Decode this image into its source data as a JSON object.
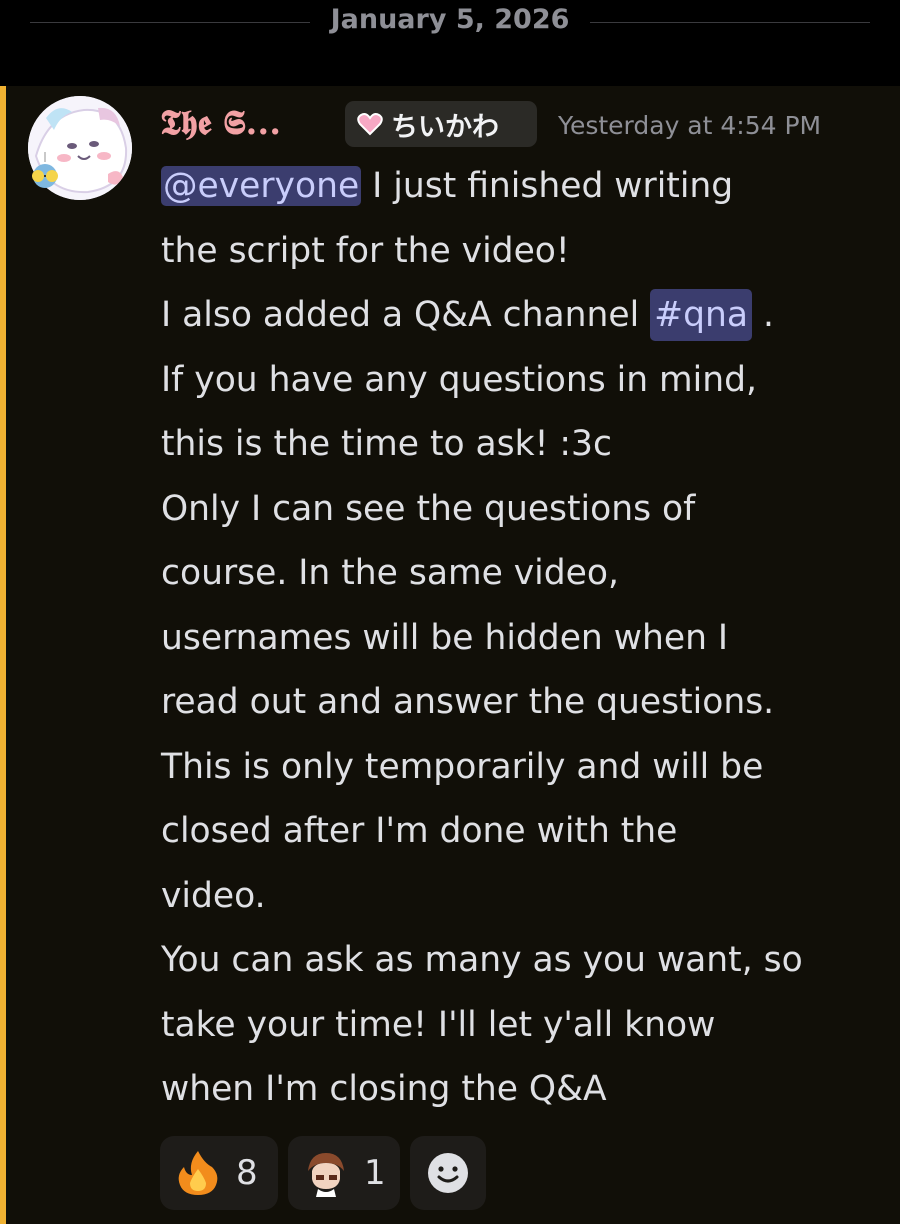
{
  "date_divider": {
    "label": "January 5, 2026"
  },
  "message": {
    "author": "𝕿𝖍𝖊 𝕾...",
    "role_tag": "ちいかわ",
    "timestamp": "Yesterday at 4:54 PM",
    "mention_everyone": "@everyone",
    "line1_rest": " I just finished writing",
    "line2": "the script for the video!",
    "line3_pre": "I also added a Q&A channel ",
    "channel_mention": "#qna",
    "line3_post": " .",
    "line4": "If you have any questions in mind,",
    "line5": "this is the time to ask! :3c",
    "line6": "Only I can see the questions of",
    "line7": "course. In the same video,",
    "line8": "usernames will be hidden when I",
    "line9": "read out and answer the questions.",
    "line10": "This is only temporarily and will be",
    "line11": "closed after I'm done with the",
    "line12": "video.",
    "line13": "You can ask as many as you want, so",
    "line14": "take your time! I'll let y'all know",
    "line15": "when I'm closing the Q&A"
  },
  "reactions": [
    {
      "icon": "fire-emoji-icon",
      "count": "8"
    },
    {
      "icon": "custom-avatar-emoji-icon",
      "count": "1"
    },
    {
      "icon": "add-reaction-icon"
    }
  ],
  "colors": {
    "mention_highlight_bar": "#f0b232",
    "message_background": "#110f08",
    "mention_pill": "#3b3d6e",
    "username": "#f2a1a4"
  }
}
